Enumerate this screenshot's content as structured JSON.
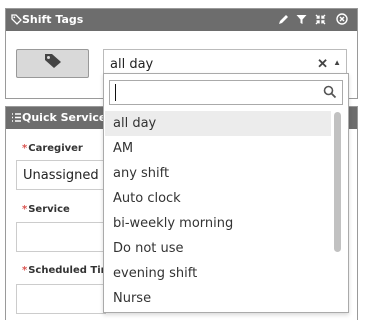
{
  "shift_tags": {
    "title": "Shift Tags",
    "header_icons": [
      "tag-icon",
      "pencil-icon",
      "filter-icon",
      "compress-icon",
      "close-circle-icon"
    ],
    "selected_value": "all day"
  },
  "tag_dropdown": {
    "search_value": "",
    "options": [
      {
        "label": "all day",
        "selected": true
      },
      {
        "label": "AM",
        "selected": false
      },
      {
        "label": "any shift",
        "selected": false
      },
      {
        "label": "Auto clock",
        "selected": false
      },
      {
        "label": "bi-weekly morning",
        "selected": false
      },
      {
        "label": "Do not use",
        "selected": false
      },
      {
        "label": "evening shift",
        "selected": false
      },
      {
        "label": "Nurse",
        "selected": false
      }
    ]
  },
  "quick_services": {
    "title": "Quick Services",
    "fields": {
      "caregiver": {
        "label": "Caregiver",
        "value": "Unassigned"
      },
      "service": {
        "label": "Service",
        "value": ""
      },
      "scheduled_time": {
        "label": "Scheduled Tim",
        "value": ""
      }
    }
  },
  "colors": {
    "header_bg": "#6d6d6d",
    "required_mark": "#d9534f",
    "selected_option_bg": "#ececec"
  }
}
